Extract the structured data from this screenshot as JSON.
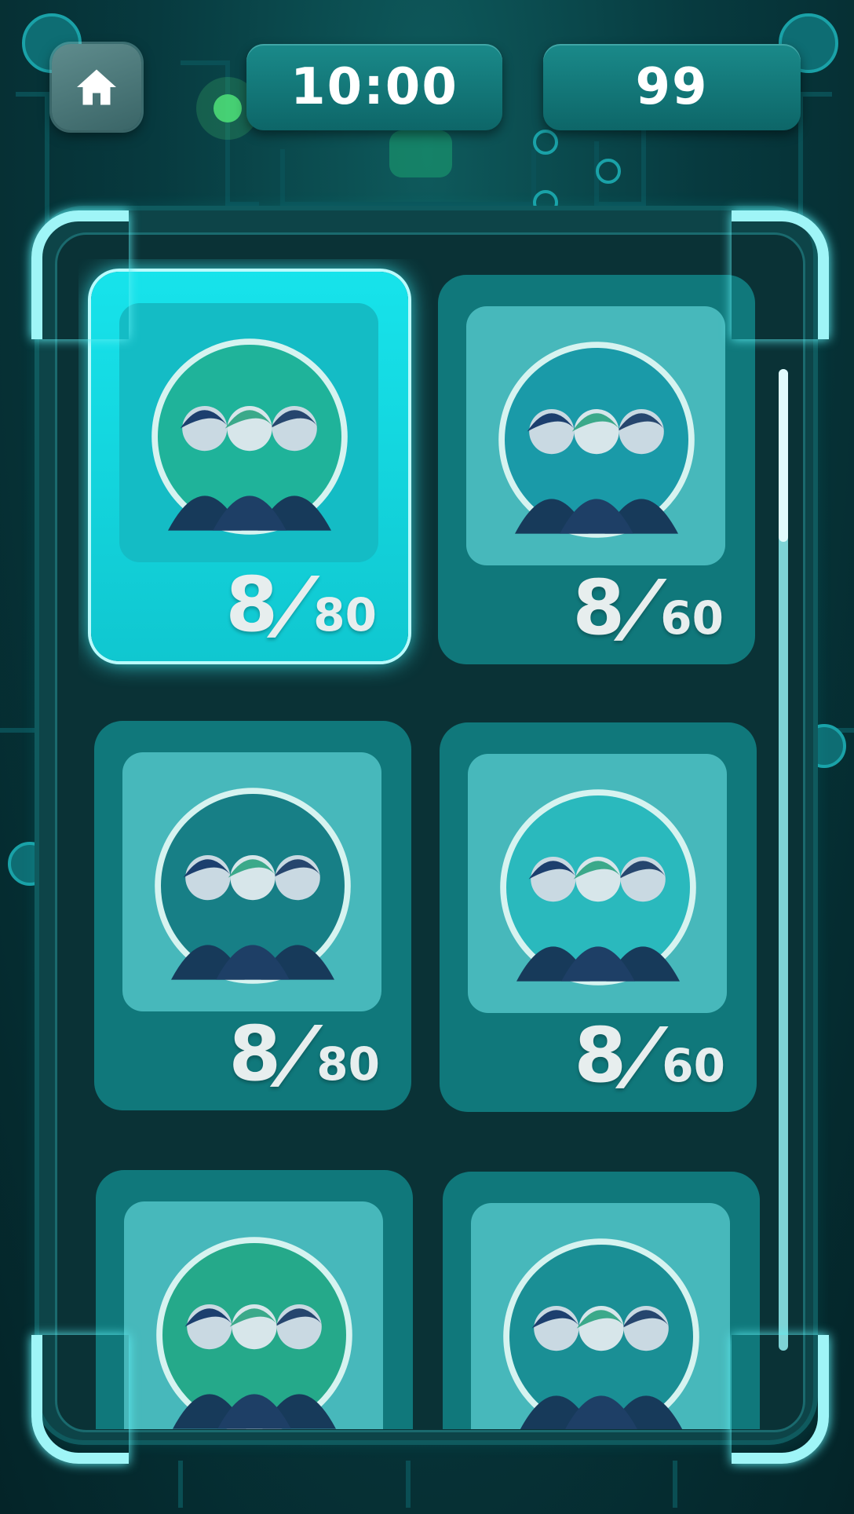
{
  "header": {
    "home_icon": "home-icon",
    "timer": "10:00",
    "score": "99"
  },
  "levels": [
    {
      "progress": "8",
      "total": "80",
      "selected": true,
      "avatar_bg": "#1fb39a"
    },
    {
      "progress": "8",
      "total": "60",
      "selected": false,
      "avatar_bg": "#1a9aa8"
    },
    {
      "progress": "8",
      "total": "80",
      "selected": false,
      "avatar_bg": "#177f86"
    },
    {
      "progress": "8",
      "total": "60",
      "selected": false,
      "avatar_bg": "#2ab9bd"
    },
    {
      "progress": "",
      "total": "",
      "selected": false,
      "avatar_bg": "#25a98a"
    },
    {
      "progress": "",
      "total": "",
      "selected": false,
      "avatar_bg": "#1a8f95"
    }
  ],
  "colors": {
    "accent": "#9ff5f7",
    "card": "#10787b",
    "card_selected": "#17e3eb",
    "text_progress": "#e7eeee"
  }
}
